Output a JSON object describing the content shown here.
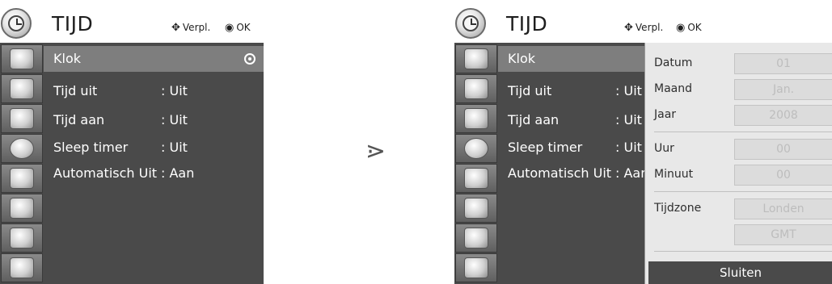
{
  "left_panel": {
    "title": "TIJD",
    "hint_move": "Verpl.",
    "hint_ok": "OK",
    "sidebar_icons": [
      "picture-icon",
      "tv-icon",
      "audio-icon",
      "clock-icon",
      "options-icon",
      "lock-icon",
      "input-icon",
      "media-icon"
    ],
    "menu": [
      {
        "label": "Klok",
        "value": ""
      },
      {
        "label": "Tijd uit",
        "value": ": Uit"
      },
      {
        "label": "Tijd aan",
        "value": ": Uit"
      },
      {
        "label": "Sleep timer",
        "value": ": Uit"
      },
      {
        "label": "Automatisch Uit",
        "value": ": Aan"
      }
    ]
  },
  "arrow_glyph": "⋗",
  "right_panel": {
    "title": "TIJD",
    "hint_move": "Verpl.",
    "hint_ok": "OK",
    "menu": [
      {
        "label": "Klok",
        "value": ""
      },
      {
        "label": "Tijd uit",
        "value": ": Uit"
      },
      {
        "label": "Tijd aan",
        "value": ": Uit"
      },
      {
        "label": "Sleep timer",
        "value": ": Uit"
      },
      {
        "label": "Automatisch Uit",
        "value": ": Aan"
      }
    ],
    "clock_settings": {
      "datum_label": "Datum",
      "datum_value": "01",
      "maand_label": "Maand",
      "maand_value": "Jan.",
      "jaar_label": "Jaar",
      "jaar_value": "2008",
      "uur_label": "Uur",
      "uur_value": "00",
      "minuut_label": "Minuut",
      "minuut_value": "00",
      "tijdzone_label": "Tijdzone",
      "tijdzone_value": "Londen",
      "gmt_value": "GMT",
      "close_label": "Sluiten"
    }
  },
  "colors": {
    "menu_bg": "#4a4a4a",
    "selected_bg": "#7e7e7e",
    "submenu_bg": "#e8e8e8"
  }
}
